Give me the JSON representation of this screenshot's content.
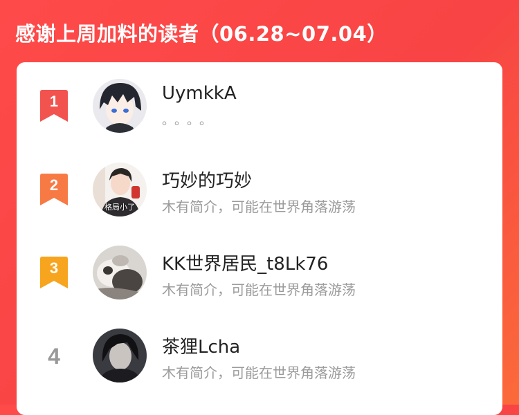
{
  "header": {
    "title": "感谢上周加料的读者（06.28~07.04）"
  },
  "readers": [
    {
      "rank": "1",
      "badge_color": "#f2534f",
      "name": "UymkkA",
      "bio": "。。。。",
      "avatar_icon": "anime-boy-avatar-icon"
    },
    {
      "rank": "2",
      "badge_color": "#f77a45",
      "name": "巧妙的巧妙",
      "bio": "木有简介，可能在世界角落游荡",
      "avatar_caption": "格局小了",
      "avatar_icon": "photo-avatar-icon"
    },
    {
      "rank": "3",
      "badge_color": "#f7a51e",
      "name": "KK世界居民_t8Lk76",
      "bio": "木有简介，可能在世界角落游荡",
      "avatar_icon": "cat-photo-avatar-icon"
    },
    {
      "rank": "4",
      "name": "茶狸Lcha",
      "bio": "木有简介，可能在世界角落游荡",
      "avatar_icon": "portrait-avatar-icon"
    }
  ]
}
